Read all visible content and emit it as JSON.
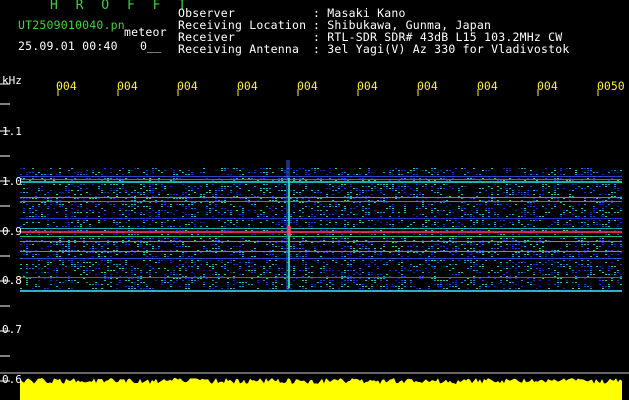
{
  "header": {
    "title": "H R O F F T",
    "filename": "UT2509010040.pn",
    "file_type": "meteor",
    "date_time": "25.09.01 00:40",
    "date_suffix": "0__",
    "info": [
      {
        "key": "Observer",
        "value": ": Masaki Kano"
      },
      {
        "key": "Receiving Location",
        "value": ": Shibukawa, Gunma, Japan"
      },
      {
        "key": "Receiver",
        "value": ": RTL-SDR SDR# 43dB L15 103.2MHz CW"
      },
      {
        "key": "Receiving Antenna",
        "value": ": 3el Yagi(V) Az 330 for Vladivostok"
      }
    ]
  },
  "axes": {
    "y_unit": "kHz",
    "y_labels": [
      "1.1",
      "1.0",
      "0.9",
      "0.8",
      "0.7",
      "0.6"
    ],
    "x_labels": [
      "004",
      "004",
      "004",
      "004",
      "004",
      "004",
      "004",
      "004",
      "004",
      "0050"
    ]
  },
  "colors": {
    "background": "#000000",
    "header_green": "#3cd43c",
    "tick_yellow": "#ffec3a",
    "power_yellow": "#ffff00"
  }
}
